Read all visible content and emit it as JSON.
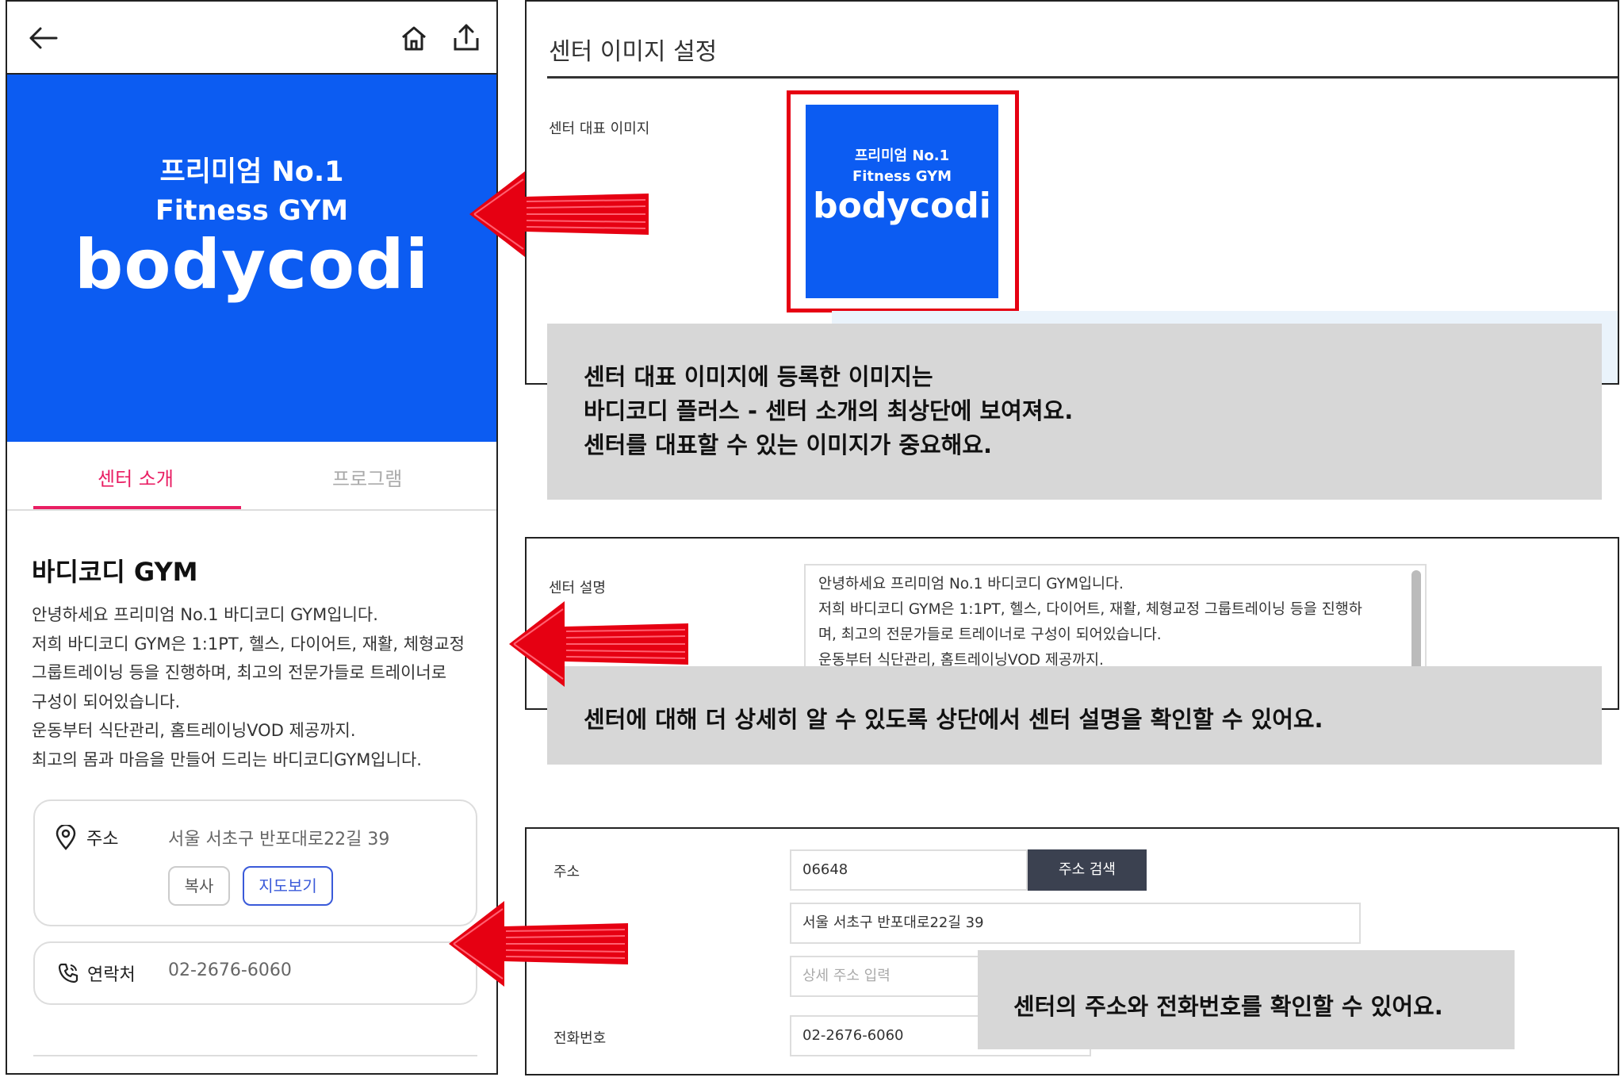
{
  "phone": {
    "banner": {
      "line1": "프리미엄 No.1",
      "line2": "Fitness GYM",
      "brand": "bodycodi"
    },
    "tabs": [
      {
        "label": "센터 소개",
        "active": true
      },
      {
        "label": "프로그램",
        "active": false
      }
    ],
    "gym_name": "바디코디 GYM",
    "description_lines": [
      "안녕하세요 프리미엄 No.1 바디코디 GYM입니다.",
      "저희 바디코디 GYM은 1:1PT, 헬스, 다이어트, 재활, 체형교정",
      "그룹트레이닝 등을 진행하며, 최고의 전문가들로 트레이너로",
      "구성이 되어있습니다.",
      "운동부터 식단관리, 홈트레이닝VOD 제공까지.",
      "최고의 몸과 마음을 만들어 드리는 바디코디GYM입니다."
    ],
    "address": {
      "label": "주소",
      "value": "서울 서초구 반포대로22길 39",
      "copy_label": "복사",
      "map_label": "지도보기"
    },
    "contact": {
      "label": "연락처",
      "value": "02-2676-6060"
    }
  },
  "image_settings": {
    "title": "센터 이미지 설정",
    "label": "센터 대표 이미지",
    "thumb_line1": "프리미엄 No.1",
    "thumb_line2": "Fitness GYM",
    "thumb_brand": "bodycodi",
    "note_lines": [
      "센터 대표 이미지에 등록한 이미지는",
      "바디코디 플러스 - 센터 소개의 최상단에 보여져요.",
      "센터를 대표할 수 있는 이미지가 중요해요."
    ]
  },
  "description_settings": {
    "label": "센터 설명",
    "text_lines": [
      "안녕하세요 프리미엄 No.1 바디코디 GYM입니다.",
      "저희 바디코디 GYM은 1:1PT, 헬스, 다이어트, 재활, 체형교정 그룹트레이닝 등을 진행하",
      "며, 최고의 전문가들로 트레이너로 구성이 되어있습니다.",
      "운동부터 식단관리, 홈트레이닝VOD 제공까지."
    ],
    "note": "센터에 대해 더 상세히 알 수 있도록 상단에서 센터 설명을 확인할 수 있어요."
  },
  "address_settings": {
    "address_label": "주소",
    "zipcode": "06648",
    "search_button": "주소 검색",
    "address_value": "서울 서초구 반포대로22길 39",
    "detail_placeholder": "상세 주소 입력",
    "phone_label": "전화번호",
    "phone_value": "02-2676-6060",
    "note": "센터의 주소와 전화번호를 확인할 수 있어요."
  },
  "colors": {
    "brand_blue": "#0c5cf2",
    "tab_active": "#e91e63",
    "highlight_red": "#e60012",
    "search_button_bg": "#3b4150",
    "note_bg": "#d7d7d7"
  },
  "icons": [
    "back-arrow-icon",
    "home-icon",
    "share-icon",
    "location-pin-icon",
    "phone-icon",
    "red-arrow-icon"
  ]
}
